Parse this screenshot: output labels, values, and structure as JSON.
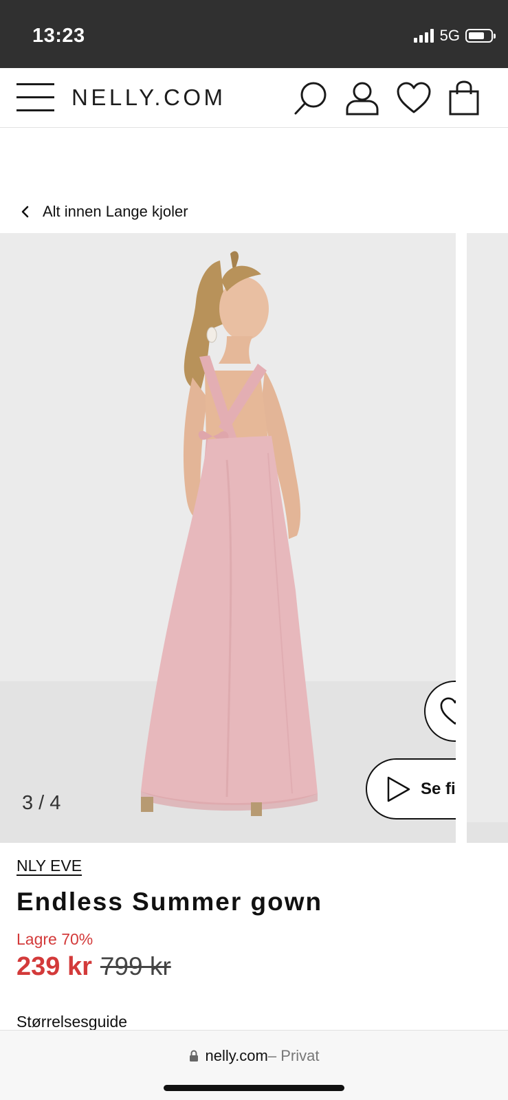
{
  "status_bar": {
    "time": "13:23",
    "network": "5G",
    "icons": [
      "signal-icon",
      "battery-icon"
    ]
  },
  "header": {
    "logo": "NELLY.COM",
    "icons": [
      "menu-icon",
      "search-icon",
      "account-icon",
      "heart-icon",
      "shopping-bag-icon"
    ]
  },
  "breadcrumb": {
    "label": "Alt innen Lange kjoler",
    "icon": "chevron-left-icon"
  },
  "gallery": {
    "counter": "3 / 4",
    "play_label": "Se film",
    "icons": [
      "heart-icon",
      "play-icon"
    ],
    "colors": {
      "background": "#ebebeb",
      "dress": "#e7b8bc"
    }
  },
  "product": {
    "brand": "NLY EVE",
    "title": "Endless Summer gown",
    "discount_label": "Lagre 70%",
    "price_now": "239 kr",
    "price_old": "799 kr",
    "size_guide": "Størrelsesguide",
    "colors": {
      "sale": "#d33a3a"
    }
  },
  "browser": {
    "domain": "nelly.com",
    "mode_text": " – Privat",
    "icon": "lock-icon"
  }
}
